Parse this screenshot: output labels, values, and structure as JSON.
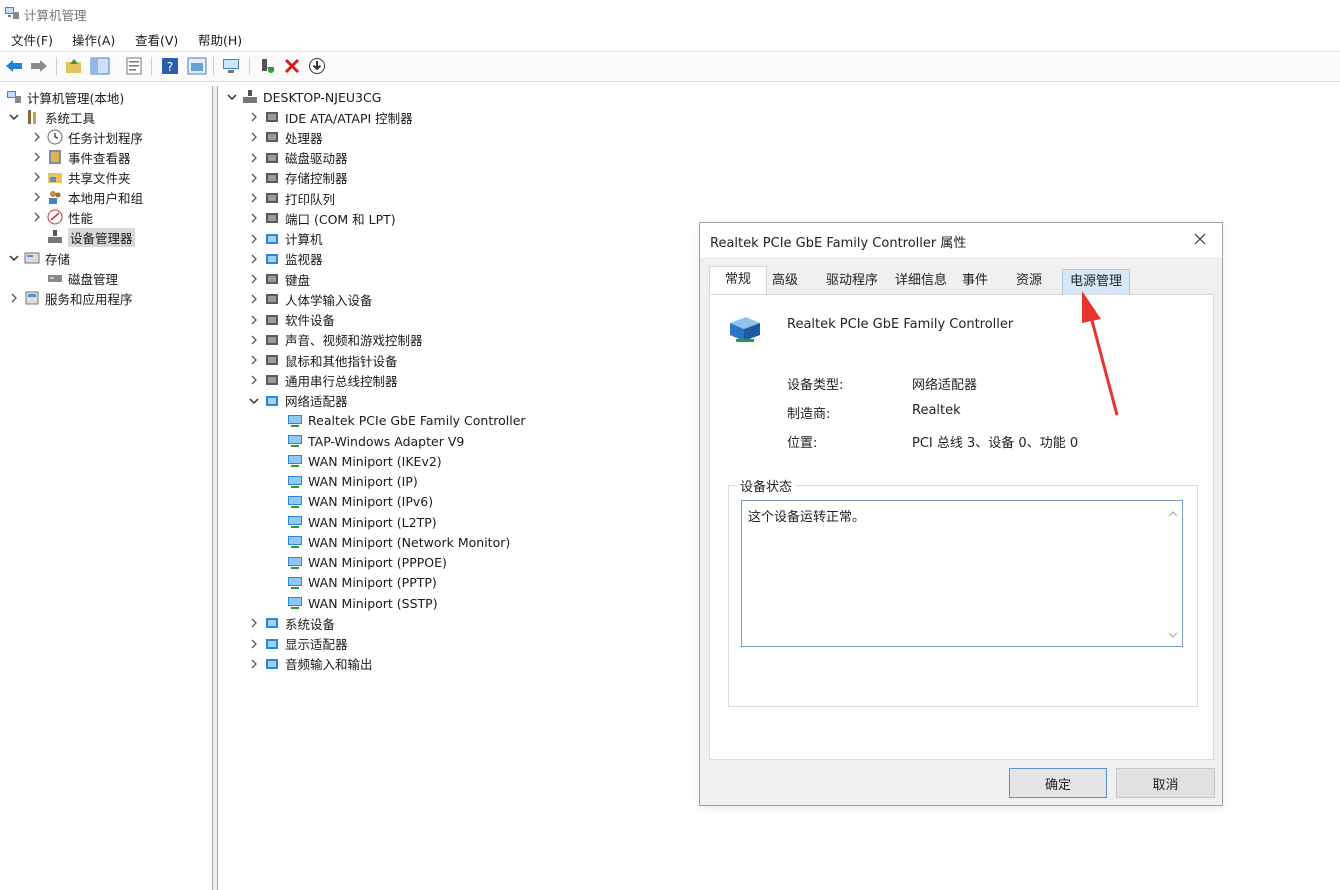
{
  "window": {
    "title": "计算机管理"
  },
  "menu": [
    "文件(F)",
    "操作(A)",
    "查看(V)",
    "帮助(H)"
  ],
  "toolbar_icons": [
    "back-arrow-icon",
    "forward-arrow-icon",
    "up-folder-icon",
    "show-tree-icon",
    "properties-icon",
    "help-icon",
    "export-icon",
    "computer-icon",
    "enable-device-icon",
    "remove-device-icon",
    "download-driver-icon"
  ],
  "left_tree": {
    "root": "计算机管理(本地)",
    "system_tools": "系统工具",
    "task_scheduler": "任务计划程序",
    "event_viewer": "事件查看器",
    "shared_folders": "共享文件夹",
    "local_users": "本地用户和组",
    "performance": "性能",
    "device_manager": "设备管理器",
    "storage": "存储",
    "disk_management": "磁盘管理",
    "services": "服务和应用程序"
  },
  "device_tree": {
    "root": "DESKTOP-NJEU3CG",
    "categories": [
      "IDE ATA/ATAPI 控制器",
      "处理器",
      "磁盘驱动器",
      "存储控制器",
      "打印队列",
      "端口 (COM 和 LPT)",
      "计算机",
      "监视器",
      "键盘",
      "人体学输入设备",
      "软件设备",
      "声音、视频和游戏控制器",
      "鼠标和其他指针设备",
      "通用串行总线控制器",
      "网络适配器"
    ],
    "network_adapters": [
      "Realtek PCIe GbE Family Controller",
      "TAP-Windows Adapter V9",
      "WAN Miniport (IKEv2)",
      "WAN Miniport (IP)",
      "WAN Miniport (IPv6)",
      "WAN Miniport (L2TP)",
      "WAN Miniport (Network Monitor)",
      "WAN Miniport (PPPOE)",
      "WAN Miniport (PPTP)",
      "WAN Miniport (SSTP)"
    ],
    "categories_after": [
      "系统设备",
      "显示适配器",
      "音频输入和输出"
    ]
  },
  "dialog": {
    "title": "Realtek PCIe GbE Family Controller 属性",
    "tabs": [
      "常规",
      "高级",
      "驱动程序",
      "详细信息",
      "事件",
      "资源",
      "电源管理"
    ],
    "device_name": "Realtek PCIe GbE Family Controller",
    "props": [
      {
        "label": "设备类型:",
        "value": "网络适配器"
      },
      {
        "label": "制造商:",
        "value": "Realtek"
      },
      {
        "label": "位置:",
        "value": "PCI 总线 3、设备 0、功能 0"
      }
    ],
    "status_group": "设备状态",
    "status_text": "这个设备运转正常。",
    "ok": "确定",
    "cancel": "取消"
  },
  "colors": {
    "accent_arrow": "#e8332f",
    "selection": "#d9d9d9",
    "tab_hover": "#d7e9f8"
  }
}
